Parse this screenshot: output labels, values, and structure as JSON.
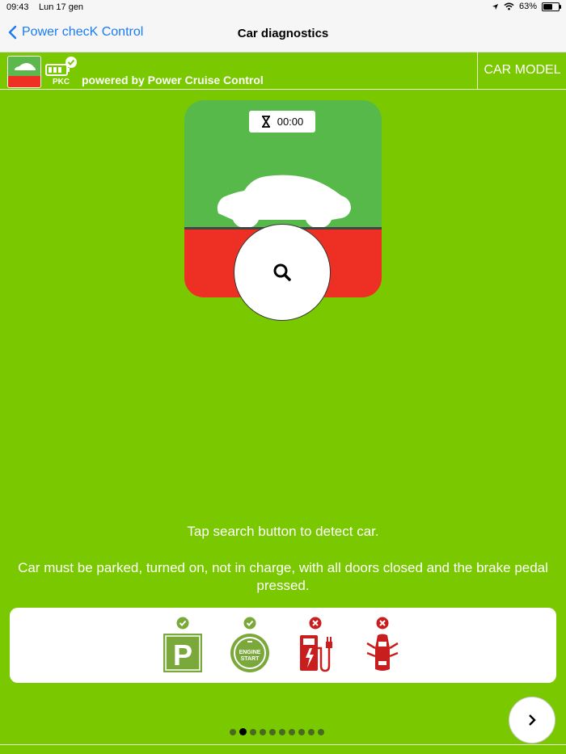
{
  "status": {
    "time": "09:43",
    "date": "Lun 17 gen",
    "battery": "63%",
    "battery_level": 0.63
  },
  "nav": {
    "back_label": "Power checK Control",
    "title": "Car diagnostics"
  },
  "appbar": {
    "logo_text": "PKC",
    "powered": "powered by Power Cruise Control",
    "car_model_label": "CAR MODEL"
  },
  "diagnostic": {
    "timer": "00:00"
  },
  "messages": {
    "tap": "Tap search button to detect car.",
    "requirements": "Car must be parked, turned on, not in charge, with all doors closed and the brake pedal pressed."
  },
  "conditions": [
    {
      "name": "parked",
      "icon": "parking-icon",
      "status": "ok",
      "label": "P"
    },
    {
      "name": "engine-start",
      "icon": "engine-start-icon",
      "status": "ok",
      "label_top": "ENGINE",
      "label_bottom": "START"
    },
    {
      "name": "charging",
      "icon": "charging-station-icon",
      "status": "error"
    },
    {
      "name": "doors",
      "icon": "car-doors-icon",
      "status": "error"
    }
  ],
  "pager": {
    "count": 10,
    "active": 1
  },
  "colors": {
    "background": "#7ac900",
    "ok": "#7aa83a",
    "error": "#c81e1e",
    "card_green": "#58b94b",
    "card_red": "#ee3024",
    "link": "#1a7cf4"
  }
}
